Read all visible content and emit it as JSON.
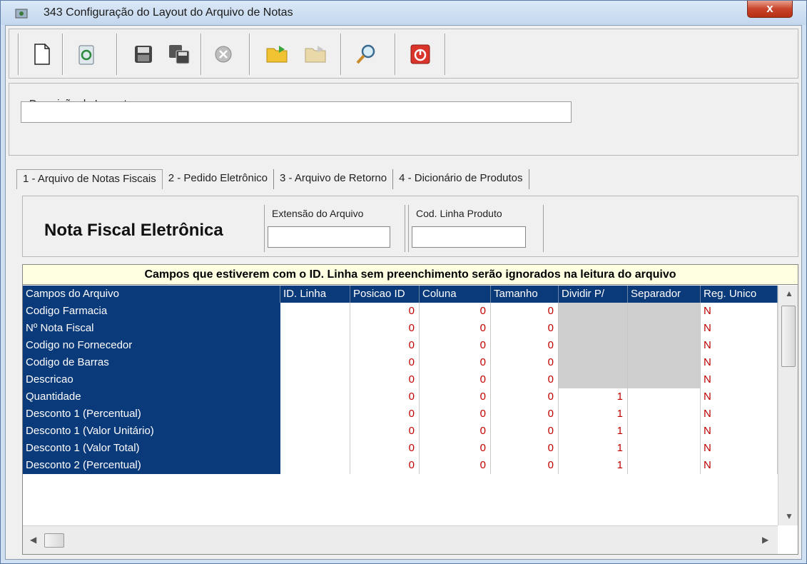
{
  "window": {
    "title": "343 Configuração do Layout do Arquivo de Notas",
    "close_label": "x"
  },
  "toolbar": {
    "buttons": [
      {
        "name": "new-document-icon"
      },
      {
        "name": "recycle-icon"
      },
      {
        "name": "save-icon"
      },
      {
        "name": "save-copy-icon"
      },
      {
        "name": "cancel-icon"
      },
      {
        "name": "open-folder-icon"
      },
      {
        "name": "export-folder-icon"
      },
      {
        "name": "search-icon"
      },
      {
        "name": "power-icon"
      }
    ]
  },
  "description": {
    "label": "Descrição do Layout",
    "value": ""
  },
  "tabs": [
    {
      "label": "1 - Arquivo de Notas Fiscais",
      "active": true
    },
    {
      "label": "2 - Pedido Eletrônico",
      "active": false
    },
    {
      "label": "3 - Arquivo de Retorno",
      "active": false
    },
    {
      "label": "4 - Dicionário de Produtos",
      "active": false
    }
  ],
  "nf": {
    "title": "Nota Fiscal Eletrônica",
    "ext_label": "Extensão do Arquivo",
    "ext_value": "",
    "cod_label": "Cod. Linha Produto",
    "cod_value": ""
  },
  "grid": {
    "notice": "Campos que estiverem com o ID. Linha sem preenchimento serão ignorados na leitura do arquivo",
    "columns": [
      "Campos do Arquivo",
      "ID. Linha",
      "Posicao ID",
      "Coluna",
      "Tamanho",
      "Dividir P/",
      "Separador",
      "Reg. Unico"
    ],
    "rows": [
      {
        "name": "Codigo Farmacia",
        "id": "",
        "pos": "0",
        "col": "0",
        "tam": "0",
        "div": "",
        "sep": "",
        "reg": "N",
        "gray": true
      },
      {
        "name": "Nº Nota Fiscal",
        "id": "",
        "pos": "0",
        "col": "0",
        "tam": "0",
        "div": "",
        "sep": "",
        "reg": "N",
        "gray": true
      },
      {
        "name": "Codigo no Fornecedor",
        "id": "",
        "pos": "0",
        "col": "0",
        "tam": "0",
        "div": "",
        "sep": "",
        "reg": "N",
        "gray": true
      },
      {
        "name": "Codigo de Barras",
        "id": "",
        "pos": "0",
        "col": "0",
        "tam": "0",
        "div": "",
        "sep": "",
        "reg": "N",
        "gray": true
      },
      {
        "name": "Descricao",
        "id": "",
        "pos": "0",
        "col": "0",
        "tam": "0",
        "div": "",
        "sep": "",
        "reg": "N",
        "gray": true
      },
      {
        "name": "Quantidade",
        "id": "",
        "pos": "0",
        "col": "0",
        "tam": "0",
        "div": "1",
        "sep": "",
        "reg": "N",
        "gray": false
      },
      {
        "name": "Desconto 1 (Percentual)",
        "id": "",
        "pos": "0",
        "col": "0",
        "tam": "0",
        "div": "1",
        "sep": "",
        "reg": "N",
        "gray": false
      },
      {
        "name": "Desconto 1 (Valor Unitário)",
        "id": "",
        "pos": "0",
        "col": "0",
        "tam": "0",
        "div": "1",
        "sep": "",
        "reg": "N",
        "gray": false
      },
      {
        "name": "Desconto 1 (Valor Total)",
        "id": "",
        "pos": "0",
        "col": "0",
        "tam": "0",
        "div": "1",
        "sep": "",
        "reg": "N",
        "gray": false
      },
      {
        "name": "Desconto 2 (Percentual)",
        "id": "",
        "pos": "0",
        "col": "0",
        "tam": "0",
        "div": "1",
        "sep": "",
        "reg": "N",
        "gray": false
      }
    ]
  }
}
